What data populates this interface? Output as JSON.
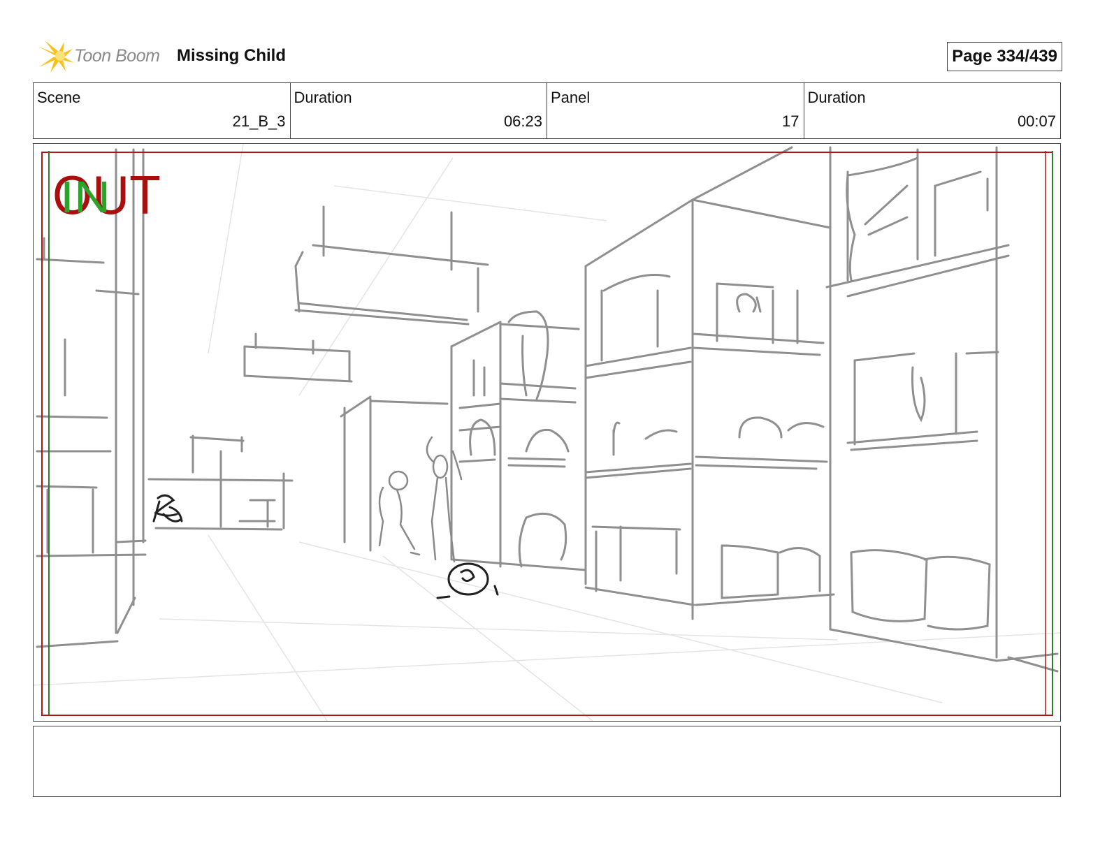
{
  "header": {
    "logo_text": "Toon Boom",
    "project_title": "Missing Child",
    "page_label": "Page 334/439"
  },
  "info": {
    "scene_label": "Scene",
    "scene_value": "21_B_3",
    "scene_duration_label": "Duration",
    "scene_duration_value": "06:23",
    "panel_label": "Panel",
    "panel_value": "17",
    "panel_duration_label": "Duration",
    "panel_duration_value": "00:07"
  },
  "panel": {
    "in_marker": "IN",
    "out_marker": "OUT",
    "in_color": "#2aa52a",
    "out_color": "#aa0f0f",
    "sketch_color": "#8f8f8f"
  },
  "notes": {
    "text": ""
  }
}
